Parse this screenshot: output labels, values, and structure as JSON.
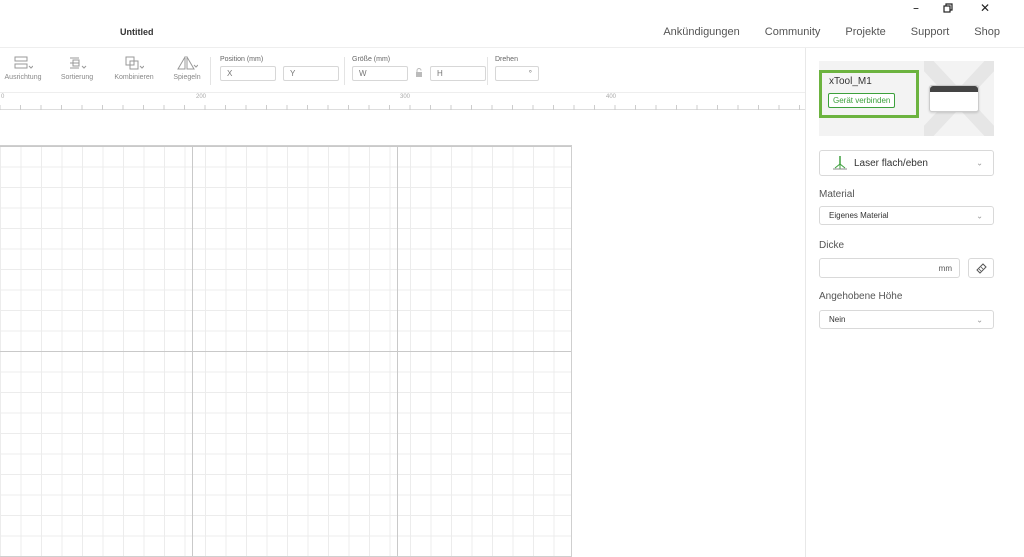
{
  "window": {
    "minimize_icon": "minimize-icon",
    "restore_icon": "restore-icon",
    "close_icon": "close-icon"
  },
  "document": {
    "title": "Untitled"
  },
  "topnav": [
    {
      "label": "Ankündigungen"
    },
    {
      "label": "Community"
    },
    {
      "label": "Projekte"
    },
    {
      "label": "Support"
    },
    {
      "label": "Shop"
    }
  ],
  "toolbar": {
    "tools": [
      {
        "label": "Ausrichtung",
        "icon": "align-icon"
      },
      {
        "label": "Sortierung",
        "icon": "sort-icon"
      },
      {
        "label": "Kombinieren",
        "icon": "combine-icon"
      },
      {
        "label": "Spiegeln",
        "icon": "mirror-icon"
      }
    ],
    "position": {
      "label": "Position (mm)",
      "x_placeholder": "X",
      "y_placeholder": "Y"
    },
    "size": {
      "label": "Größe (mm)",
      "w_placeholder": "W",
      "h_placeholder": "H"
    },
    "rotate": {
      "label": "Drehen",
      "placeholder": "°"
    }
  },
  "ruler": {
    "labels": [
      "0",
      "200",
      "300",
      "400"
    ]
  },
  "panel": {
    "device": {
      "name": "xTool_M1",
      "connect_label": "Gerät verbinden"
    },
    "laser_mode": {
      "value": "Laser flach/eben"
    },
    "material": {
      "label": "Material",
      "value": "Eigenes Material"
    },
    "thickness": {
      "label": "Dicke",
      "unit": "mm"
    },
    "raised_height": {
      "label": "Angehobene Höhe",
      "value": "Nein"
    }
  },
  "colors": {
    "accent_green": "#3ca03c",
    "highlight_green": "#6cb33f"
  }
}
